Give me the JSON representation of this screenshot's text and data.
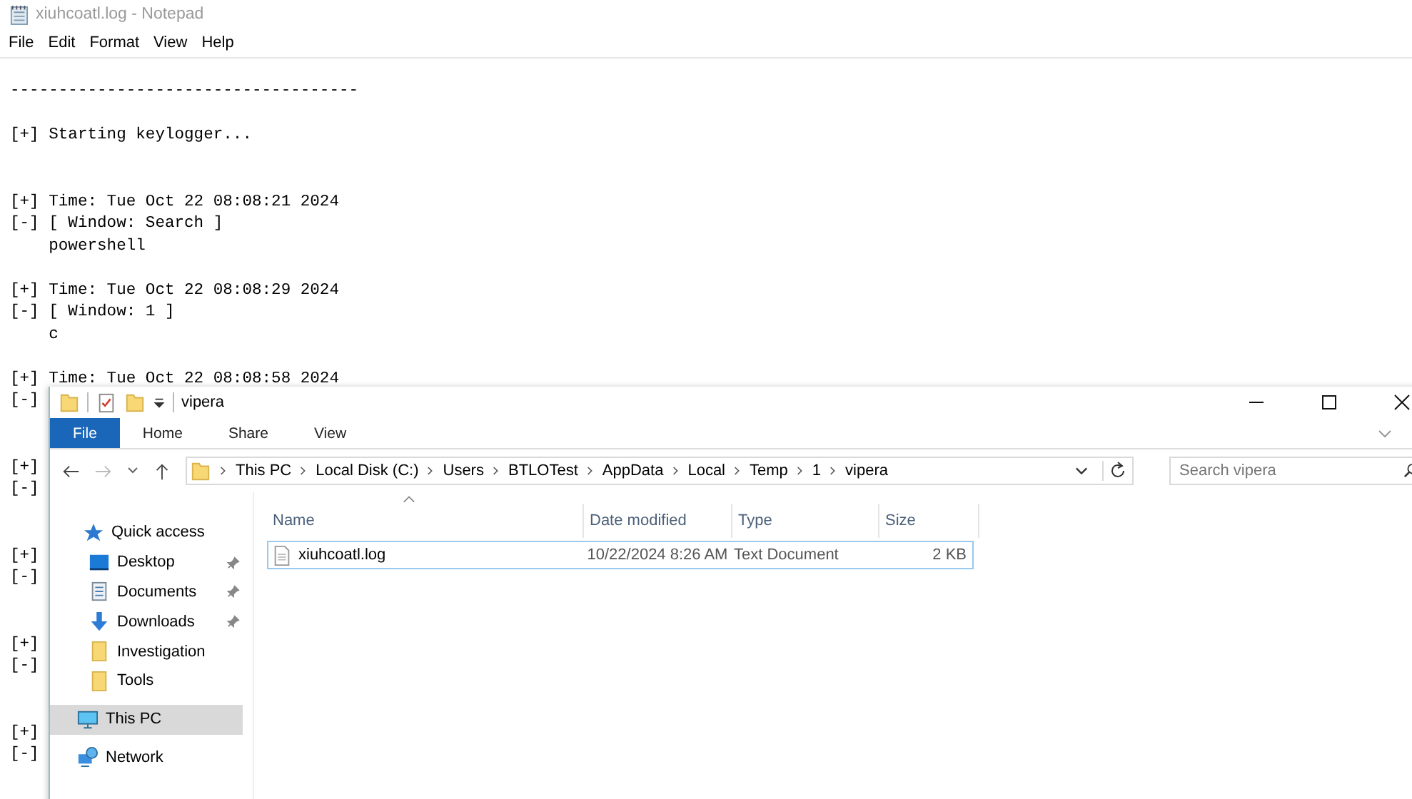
{
  "notepad": {
    "title": "xiuhcoatl.log - Notepad",
    "menu": [
      "File",
      "Edit",
      "Format",
      "View",
      "Help"
    ],
    "lines": [
      {
        "kind": "text",
        "text": "------------------------------------"
      },
      {
        "kind": "blank"
      },
      {
        "kind": "text",
        "text": "[+] Starting keylogger..."
      },
      {
        "kind": "blank"
      },
      {
        "kind": "blank"
      },
      {
        "kind": "text",
        "text": "[+] Time: Tue Oct 22 08:08:21 2024"
      },
      {
        "kind": "text",
        "text": "[-] [ Window: Search ]"
      },
      {
        "kind": "text",
        "text": "    powershell"
      },
      {
        "kind": "blank"
      },
      {
        "kind": "text",
        "text": "[+] Time: Tue Oct 22 08:08:29 2024"
      },
      {
        "kind": "text",
        "text": "[-] [ Window: 1 ]"
      },
      {
        "kind": "text",
        "text": "    c"
      },
      {
        "kind": "blank"
      },
      {
        "kind": "text",
        "text": "[+] Time: Tue Oct 22 08:08:58 2024"
      },
      {
        "kind": "text",
        "text": "[-]"
      },
      {
        "kind": "blank"
      },
      {
        "kind": "blank"
      },
      {
        "kind": "text",
        "text": "[+]"
      },
      {
        "kind": "text",
        "text": "[-]"
      },
      {
        "kind": "blank"
      },
      {
        "kind": "blank"
      },
      {
        "kind": "text",
        "text": "[+]"
      },
      {
        "kind": "text",
        "text": "[-]"
      },
      {
        "kind": "blank"
      },
      {
        "kind": "blank"
      },
      {
        "kind": "text",
        "text": "[+]"
      },
      {
        "kind": "text",
        "text": "[-]"
      },
      {
        "kind": "blank"
      },
      {
        "kind": "blank"
      },
      {
        "kind": "text",
        "text": "[+]"
      },
      {
        "kind": "text",
        "text": "[-]"
      }
    ]
  },
  "explorer": {
    "title": "vipera",
    "ribbon_tabs": [
      {
        "label": "File",
        "selected": true
      },
      {
        "label": "Home",
        "selected": false
      },
      {
        "label": "Share",
        "selected": false
      },
      {
        "label": "View",
        "selected": false
      }
    ],
    "breadcrumbs": [
      "This PC",
      "Local Disk (C:)",
      "Users",
      "BTLOTest",
      "AppData",
      "Local",
      "Temp",
      "1",
      "vipera"
    ],
    "search": {
      "placeholder": "Search vipera"
    },
    "nav": [
      {
        "label": "Quick access",
        "kind": "star",
        "pinned": false,
        "selected": false
      },
      {
        "label": "Desktop",
        "kind": "desktop",
        "pinned": true,
        "selected": false
      },
      {
        "label": "Documents",
        "kind": "documents",
        "pinned": true,
        "selected": false
      },
      {
        "label": "Downloads",
        "kind": "downloads",
        "pinned": true,
        "selected": false
      },
      {
        "label": "Investigation",
        "kind": "folder",
        "pinned": false,
        "selected": false
      },
      {
        "label": "Tools",
        "kind": "folder",
        "pinned": false,
        "selected": false
      },
      {
        "label": "This PC",
        "kind": "pc",
        "pinned": false,
        "selected": true
      },
      {
        "label": "Network",
        "kind": "network",
        "pinned": false,
        "selected": false
      }
    ],
    "columns": [
      "Name",
      "Date modified",
      "Type",
      "Size"
    ],
    "files": [
      {
        "name": "xiuhcoatl.log",
        "date": "10/22/2024 8:26 AM",
        "type": "Text Document",
        "size": "2 KB",
        "selected": true
      }
    ]
  }
}
